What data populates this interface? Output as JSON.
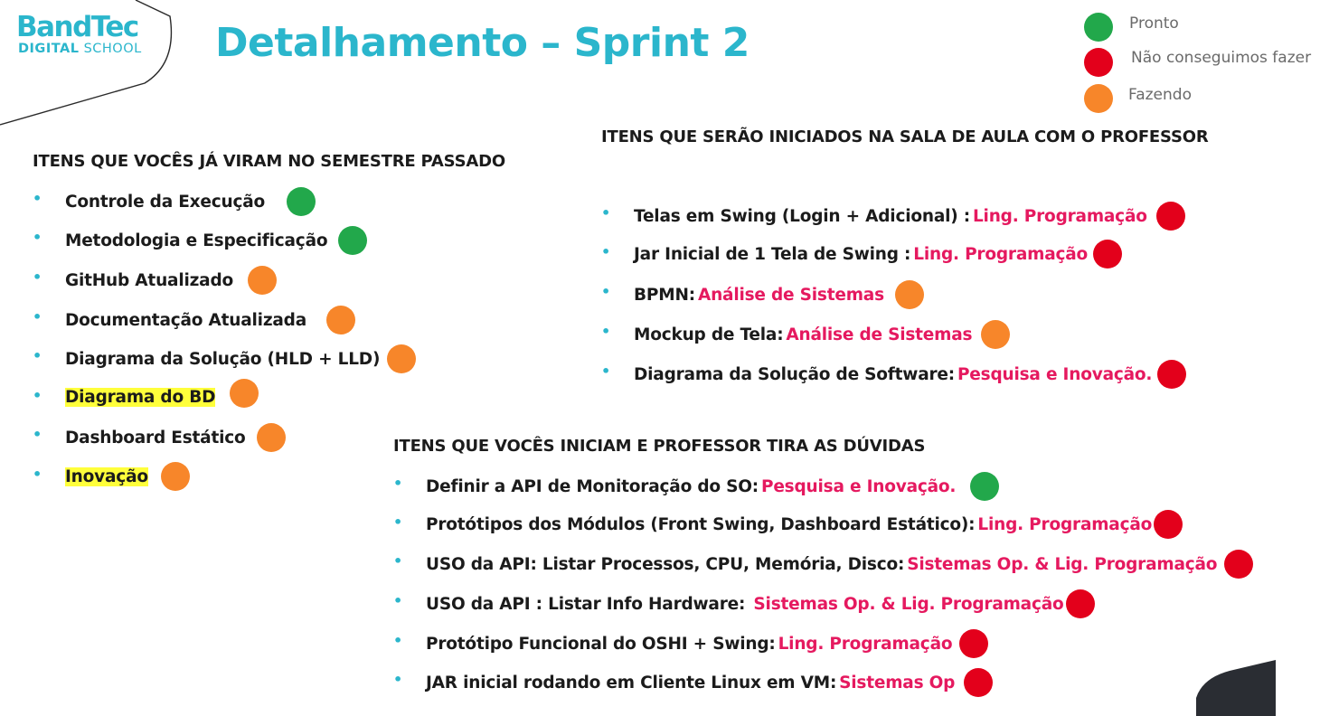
{
  "colors": {
    "accent": "#2bb6cc",
    "subject": "#e5195f",
    "highlight": "#ffff3b",
    "pronto": "#22a84b",
    "nao_conseguimos": "#e3001b",
    "fazendo": "#f7862a"
  },
  "logo": {
    "brand": "BandTec",
    "sub_bold": "DIGITAL",
    "sub_light": "SCHOOL"
  },
  "title": "Detalhamento – Sprint 2",
  "legend": [
    {
      "label": "Pronto",
      "status": "pronto"
    },
    {
      "label": "Não conseguimos fazer",
      "status": "nao_conseguimos"
    },
    {
      "label": "Fazendo",
      "status": "fazendo"
    }
  ],
  "left_section": {
    "heading": "ITENS QUE VOCÊS JÁ VIRAM NO SEMESTRE PASSADO",
    "items": [
      {
        "label": "Controle da Execução",
        "status": "pronto",
        "highlight": false
      },
      {
        "label": "Metodologia e Especificação",
        "status": "pronto",
        "highlight": false
      },
      {
        "label": "GitHub Atualizado",
        "status": "fazendo",
        "highlight": false
      },
      {
        "label": "Documentação Atualizada",
        "status": "fazendo",
        "highlight": false
      },
      {
        "label": "Diagrama da Solução (HLD + LLD)",
        "status": "fazendo",
        "highlight": false
      },
      {
        "label": "Diagrama do BD",
        "status": "fazendo",
        "highlight": true
      },
      {
        "label": "Dashboard Estático",
        "status": "fazendo",
        "highlight": false
      },
      {
        "label": "Inovação",
        "status": "fazendo",
        "highlight": true
      }
    ]
  },
  "right_section": {
    "heading": "ITENS QUE SERÃO INICIADOS NA SALA DE AULA COM O PROFESSOR",
    "items": [
      {
        "label": "Telas em Swing  (Login + Adicional) :",
        "subject": "Ling. Programação",
        "status": "nao_conseguimos"
      },
      {
        "label": "Jar Inicial de 1 Tela de Swing :",
        "subject": "Ling. Programação",
        "status": "nao_conseguimos"
      },
      {
        "label": "BPMN:",
        "subject": "Análise de Sistemas",
        "status": "fazendo"
      },
      {
        "label": "Mockup de Tela:",
        "subject": "Análise de Sistemas",
        "status": "fazendo"
      },
      {
        "label": "Diagrama da Solução de Software:",
        "subject": "Pesquisa e Inovação.",
        "status": "nao_conseguimos"
      }
    ]
  },
  "bottom_section": {
    "heading": "ITENS QUE VOCÊS INICIAM E PROFESSOR TIRA AS DÚVIDAS",
    "items": [
      {
        "label": "Definir a API de Monitoração do SO:",
        "subject": "Pesquisa e Inovação.",
        "status": "pronto"
      },
      {
        "label": "Protótipos dos Módulos (Front Swing, Dashboard Estático):",
        "subject": "Ling. Programação",
        "status": "nao_conseguimos"
      },
      {
        "label": "USO da API: Listar Processos, CPU, Memória, Disco:",
        "subject": "Sistemas Op. & Lig. Programação",
        "status": "nao_conseguimos"
      },
      {
        "label": "USO da API : Listar Info Hardware:",
        "subject": " Sistemas Op. & Lig. Programação",
        "status": "nao_conseguimos"
      },
      {
        "label": "Protótipo Funcional do OSHI + Swing:",
        "subject": "Ling. Programação",
        "status": "nao_conseguimos"
      },
      {
        "label": "JAR inicial rodando em Cliente Linux em VM:",
        "subject": "Sistemas Op",
        "status": "nao_conseguimos"
      }
    ]
  }
}
